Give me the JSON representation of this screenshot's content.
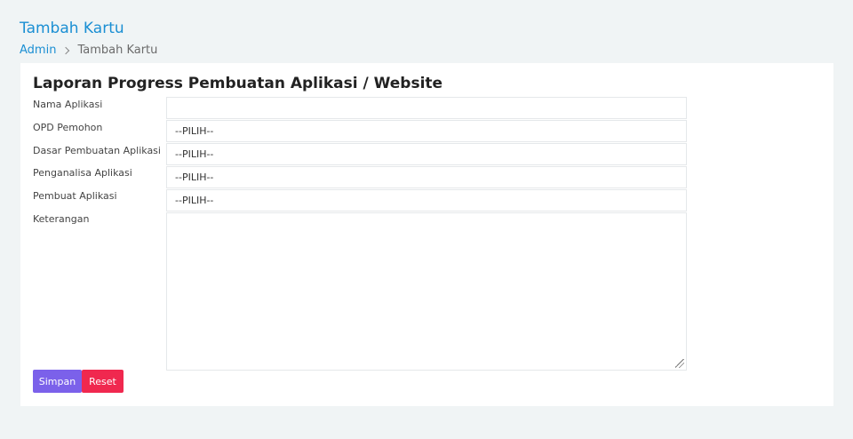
{
  "header": {
    "title": "Tambah Kartu",
    "breadcrumb": {
      "link": "Admin",
      "current": "Tambah Kartu"
    }
  },
  "form": {
    "title": "Laporan Progress Pembuatan Aplikasi / Website",
    "fields": [
      {
        "label": "Nama Aplikasi",
        "value": ""
      },
      {
        "label": "OPD Pemohon",
        "value": "--PILIH--"
      },
      {
        "label": "Dasar Pembuatan Aplikasi",
        "value": "--PILIH--"
      },
      {
        "label": "Penganalisa Aplikasi",
        "value": "--PILIH--"
      },
      {
        "label": "Pembuat Aplikasi",
        "value": "--PILIH--"
      },
      {
        "label": "Keterangan",
        "value": ""
      }
    ],
    "buttons": {
      "save": "Simpan",
      "reset": "Reset"
    }
  }
}
